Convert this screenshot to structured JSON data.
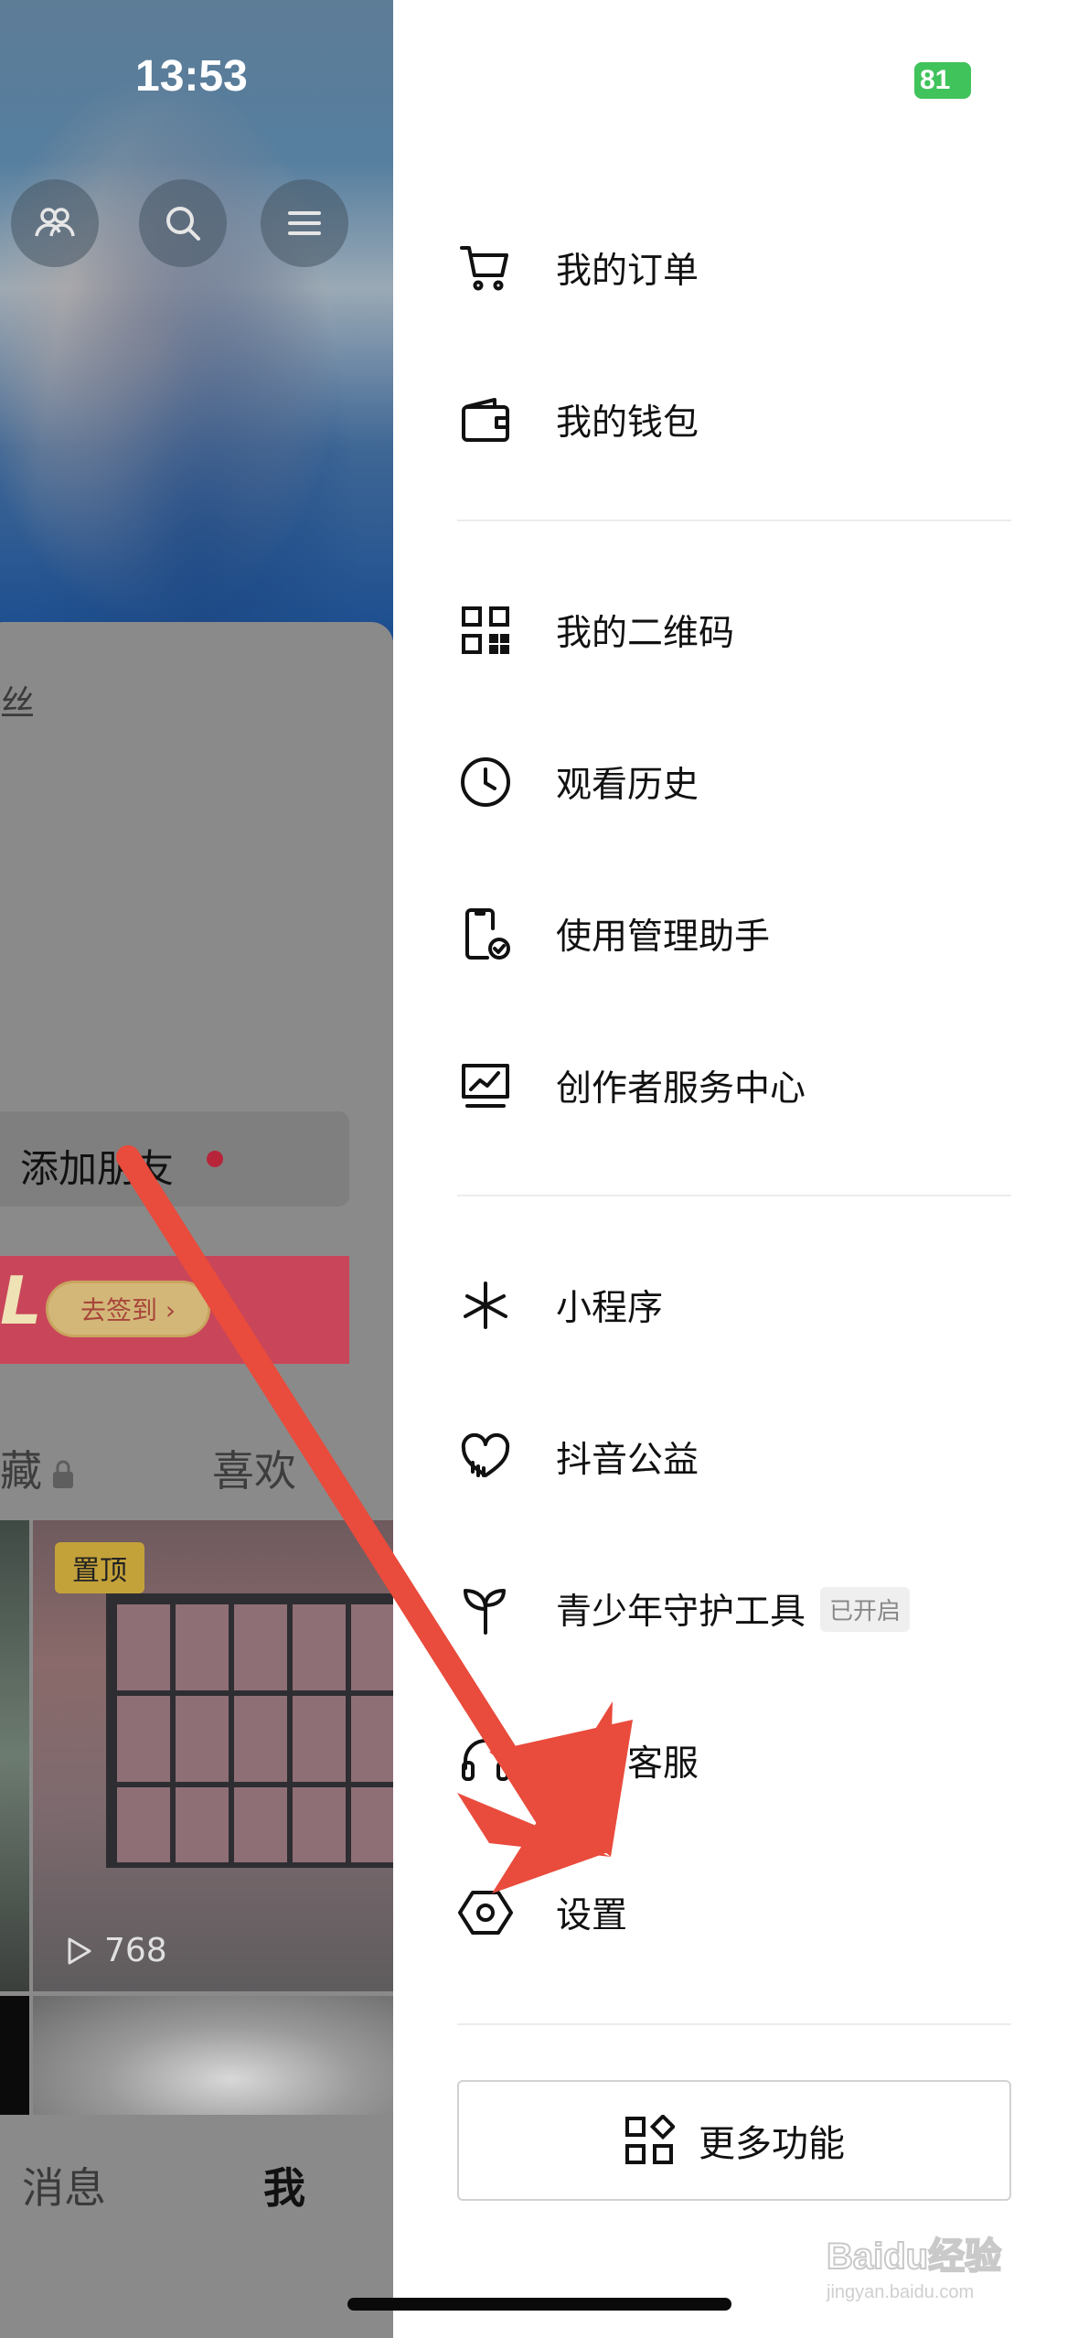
{
  "status_bar": {
    "time": "13:53",
    "battery": "81"
  },
  "background": {
    "partial_label_fans": "丝",
    "add_friend_label": "添加朋友",
    "promo": {
      "letter": "L",
      "button": "去签到 ›"
    },
    "tabs": {
      "collect": "藏",
      "like": "喜欢"
    },
    "pinned_badge": "置顶",
    "play_count": "768",
    "bottom_nav": {
      "messages": "消息",
      "me": "我"
    }
  },
  "drawer": {
    "menu": [
      {
        "label": "我的订单",
        "icon": "cart-icon"
      },
      {
        "label": "我的钱包",
        "icon": "wallet-icon"
      },
      {
        "label": "我的二维码",
        "icon": "qrcode-icon"
      },
      {
        "label": "观看历史",
        "icon": "clock-icon"
      },
      {
        "label": "使用管理助手",
        "icon": "phone-check-icon"
      },
      {
        "label": "创作者服务中心",
        "icon": "chart-board-icon"
      },
      {
        "label": "小程序",
        "icon": "mini-program-icon"
      },
      {
        "label": "抖音公益",
        "icon": "heart-hands-icon"
      },
      {
        "label": "青少年守护工具",
        "icon": "sprout-icon",
        "badge": "已开启"
      },
      {
        "label": "我的客服",
        "icon": "headset-icon"
      },
      {
        "label": "设置",
        "icon": "hexagon-settings-icon"
      }
    ],
    "more_button": "更多功能"
  },
  "watermark": {
    "text": "Baidu经验",
    "sub": "jingyan.baidu.com"
  },
  "colors": {
    "accent_red": "#e94b3c",
    "battery_green": "#3fc35a"
  }
}
